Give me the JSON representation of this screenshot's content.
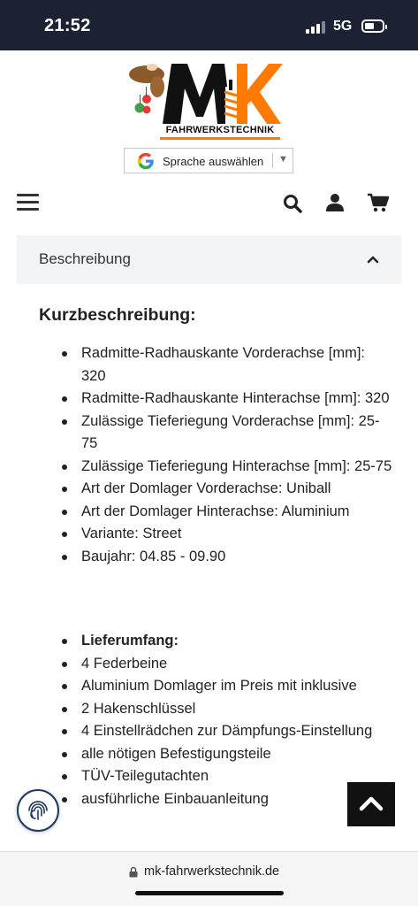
{
  "status_bar": {
    "time": "21:52",
    "network": "5G"
  },
  "logo": {
    "subtitle": "FAHRWERKSTECHNIK",
    "accent_color": "#ff7a00",
    "mark": "MK"
  },
  "translate_widget": {
    "label": "Sprache auswählen"
  },
  "header_icons": [
    "menu-icon",
    "search-icon",
    "user-icon",
    "cart-icon"
  ],
  "accordion": {
    "title": "Beschreibung",
    "expanded": true
  },
  "content": {
    "title": "Kurzbeschreibung:",
    "specs": [
      "Radmitte-Radhauskante Vorderachse [mm]: 320",
      "Radmitte-Radhauskante Hinterachse [mm]: 320",
      "Zulässige Tieferiegung Vorderachse [mm]: 25-75",
      "Zulässige Tieferiegung Hinterachse [mm]: 25-75",
      "Art der Domlager Vorderachse: Uniball",
      "Art der Domlager Hinterachse: Aluminium",
      "Variante: Street",
      "Baujahr: 04.85 - 09.90"
    ],
    "delivery_title": "Lieferumfang:",
    "delivery": [
      "4 Federbeine",
      "Aluminium Domlager im Preis mit inklusive",
      "2 Hakenschlüssel",
      "4 Einstellrädchen zur Dämpfungs-Einstellung",
      "alle nötigen Befestigungsteile",
      "TÜV-Teilegutachten",
      "ausführliche Einbauanleitung"
    ]
  },
  "url_bar": {
    "url": "mk-fahrwerkstechnik.de"
  }
}
